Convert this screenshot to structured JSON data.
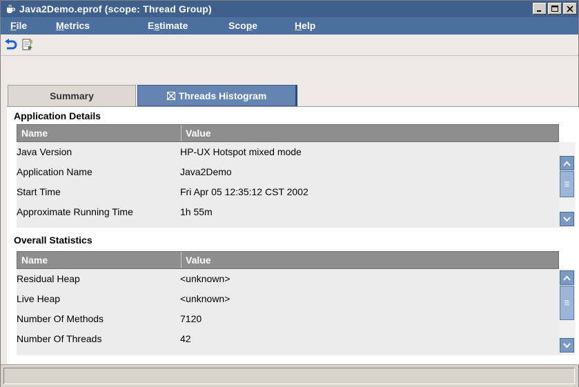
{
  "window": {
    "title": "Java2Demo.eprof (scope: Thread Group)",
    "icon": "coffee-cup-icon",
    "controls": [
      "minimize-icon",
      "maximize-icon",
      "close-icon"
    ]
  },
  "menu": {
    "file": {
      "pre": "",
      "key": "F",
      "post": "ile"
    },
    "metrics": {
      "pre": "",
      "key": "M",
      "post": "etrics"
    },
    "estimate": {
      "pre": "E",
      "key": "s",
      "post": "timate"
    },
    "scope": {
      "pre": "Sco",
      "key": "p",
      "post": "e"
    },
    "help": {
      "pre": "",
      "key": "H",
      "post": "elp"
    }
  },
  "toolbar": {
    "buttons": [
      "undo-icon",
      "export-icon"
    ]
  },
  "tabs": {
    "summary": "Summary",
    "threads_histogram": "Threads Histogram"
  },
  "application_details": {
    "title": "Application Details",
    "headers": {
      "name": "Name",
      "value": "Value"
    },
    "rows": [
      {
        "name": "Java Version",
        "value": "HP-UX Hotspot mixed mode"
      },
      {
        "name": "Application Name",
        "value": "Java2Demo"
      },
      {
        "name": "Start Time",
        "value": "Fri Apr 05 12:35:12 CST 2002"
      },
      {
        "name": "Approximate Running Time",
        "value": "1h 55m"
      }
    ]
  },
  "overall_statistics": {
    "title": "Overall Statistics",
    "headers": {
      "name": "Name",
      "value": "Value"
    },
    "rows": [
      {
        "name": "Residual Heap",
        "value": "<unknown>"
      },
      {
        "name": "Live Heap",
        "value": "<unknown>"
      },
      {
        "name": "Number Of Methods",
        "value": "7120"
      },
      {
        "name": "Number Of Threads",
        "value": "42"
      }
    ]
  },
  "status": {
    "text": ""
  },
  "colors": {
    "title_bar": "#3f5f8c",
    "menu_bar": "#4b6f9e",
    "active_tab": "#6485b2",
    "table_header": "#8e8e8e",
    "scroll_button": "#7a9ac4"
  }
}
